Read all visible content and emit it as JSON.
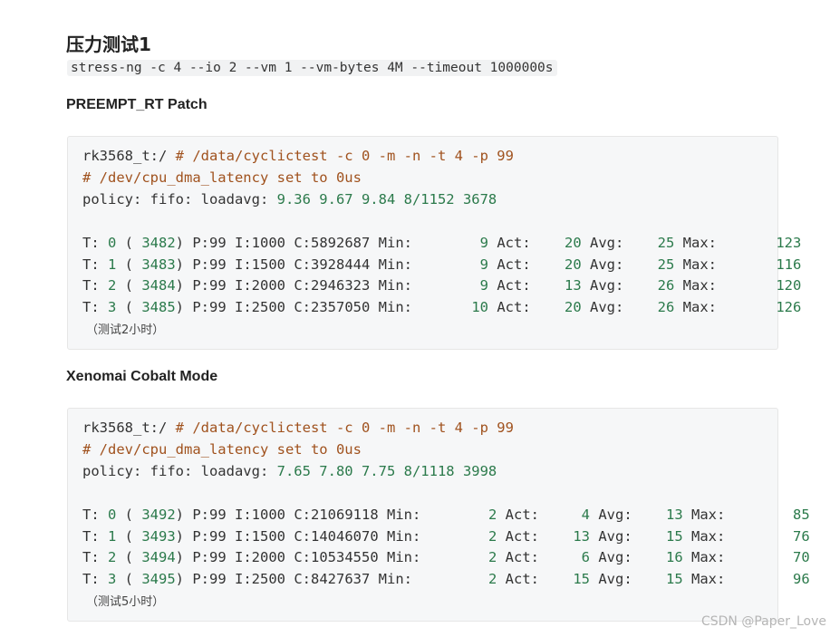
{
  "article": {
    "heading": "压力测试1",
    "command": "stress-ng -c 4 --io 2 --vm 1 --vm-bytes 4M --timeout 1000000s",
    "sections": [
      {
        "title": "PREEMPT_RT Patch",
        "prompt": "rk3568_t:/",
        "cmd": "# /data/cyclictest -c 0 -m -n -t 4 -p 99",
        "latency_line": "# /dev/cpu_dma_latency set to 0us",
        "policy_prefix": "policy: fifo: loadavg: ",
        "loadavg": "9.36 9.67 9.84 8/1152 3678",
        "rows": [
          {
            "thread": "0",
            "pid": "3482",
            "prio": "99",
            "interval": "1000",
            "count": "5892687",
            "min": "9",
            "act": "20",
            "avg": "25",
            "max": "123"
          },
          {
            "thread": "1",
            "pid": "3483",
            "prio": "99",
            "interval": "1500",
            "count": "3928444",
            "min": "9",
            "act": "20",
            "avg": "25",
            "max": "116"
          },
          {
            "thread": "2",
            "pid": "3484",
            "prio": "99",
            "interval": "2000",
            "count": "2946323",
            "min": "9",
            "act": "13",
            "avg": "26",
            "max": "120"
          },
          {
            "thread": "3",
            "pid": "3485",
            "prio": "99",
            "interval": "2500",
            "count": "2357050",
            "min": "10",
            "act": "20",
            "avg": "26",
            "max": "126"
          }
        ],
        "note": "（测试2小时）"
      },
      {
        "title": "Xenomai Cobalt Mode",
        "prompt": "rk3568_t:/",
        "cmd": "# /data/cyclictest -c 0 -m -n -t 4 -p 99",
        "latency_line": "# /dev/cpu_dma_latency set to 0us",
        "policy_prefix": "policy: fifo: loadavg: ",
        "loadavg": "7.65 7.80 7.75 8/1118 3998",
        "rows": [
          {
            "thread": "0",
            "pid": "3492",
            "prio": "99",
            "interval": "1000",
            "count": "21069118",
            "min": "2",
            "act": "4",
            "avg": "13",
            "max": "85"
          },
          {
            "thread": "1",
            "pid": "3493",
            "prio": "99",
            "interval": "1500",
            "count": "14046070",
            "min": "2",
            "act": "13",
            "avg": "15",
            "max": "76"
          },
          {
            "thread": "2",
            "pid": "3494",
            "prio": "99",
            "interval": "2000",
            "count": "10534550",
            "min": "2",
            "act": "6",
            "avg": "16",
            "max": "70"
          },
          {
            "thread": "3",
            "pid": "3495",
            "prio": "99",
            "interval": "2500",
            "count": "8427637",
            "min": "2",
            "act": "15",
            "avg": "15",
            "max": "96"
          }
        ],
        "note": "（测试5小时）"
      }
    ]
  },
  "watermark": "CSDN @Paper_Love",
  "colors": {
    "comment": "#a0521e",
    "number": "#2b7a4b",
    "code_bg": "#f6f7f8",
    "inline_code_bg": "#f1f2f3"
  }
}
